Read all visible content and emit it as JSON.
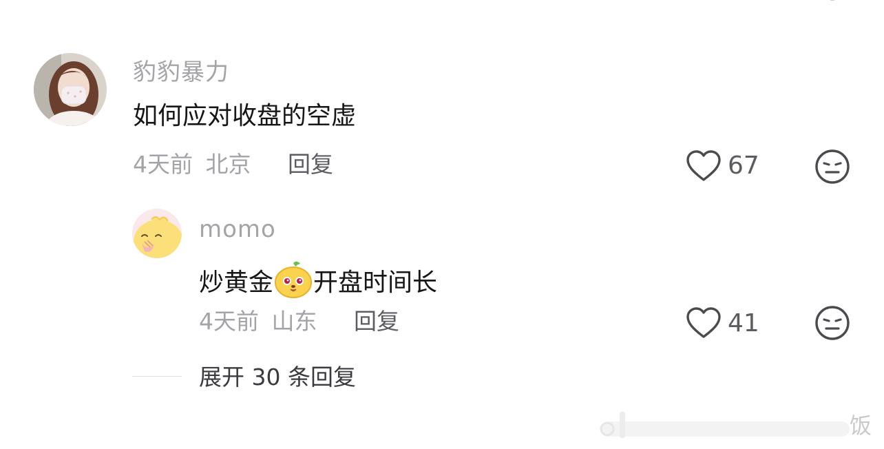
{
  "comments": [
    {
      "username": "豹豹暴力",
      "text": "如何应对收盘的空虚",
      "time": "4天前",
      "location": "北京",
      "reply_label": "回复",
      "likes": "67"
    },
    {
      "username": "momo",
      "text_before": "炒黄金",
      "text_after": "开盘时间长",
      "time": "4天前",
      "location": "山东",
      "reply_label": "回复",
      "likes": "41"
    }
  ],
  "expand_replies": "展开 30 条回复",
  "watermark": "饭",
  "icons": {
    "like": "heart-outline-icon",
    "dislike": "expressionless-face-icon",
    "inline_emoji": "yellow-cartoon-emoji"
  },
  "colors": {
    "secondary_text": "#a3a3a8",
    "primary_text": "#161616",
    "action_text": "#5b5b60"
  }
}
